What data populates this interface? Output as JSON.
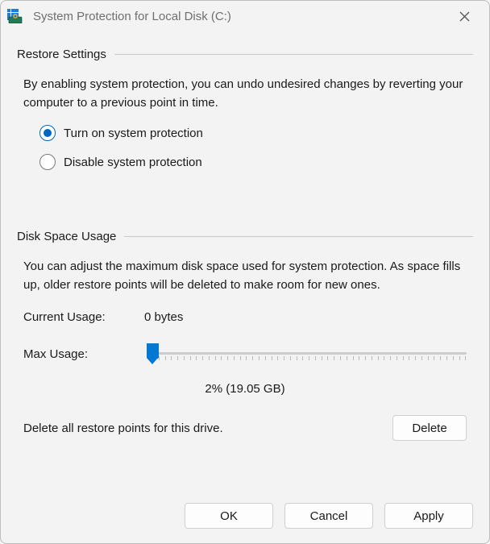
{
  "titlebar": {
    "title": "System Protection for Local Disk (C:)"
  },
  "restore": {
    "header": "Restore Settings",
    "description": "By enabling system protection, you can undo undesired changes by reverting your computer to a previous point in time.",
    "radios": {
      "turn_on": "Turn on system protection",
      "disable": "Disable system protection"
    }
  },
  "disk": {
    "header": "Disk Space Usage",
    "description": "You can adjust the maximum disk space used for system protection. As space fills up, older restore points will be deleted to make room for new ones.",
    "current_label": "Current Usage:",
    "current_value": "0 bytes",
    "max_label": "Max Usage:",
    "slider_value": "2% (19.05 GB)",
    "delete_text": "Delete all restore points for this drive.",
    "delete_button": "Delete"
  },
  "buttons": {
    "ok": "OK",
    "cancel": "Cancel",
    "apply": "Apply"
  }
}
